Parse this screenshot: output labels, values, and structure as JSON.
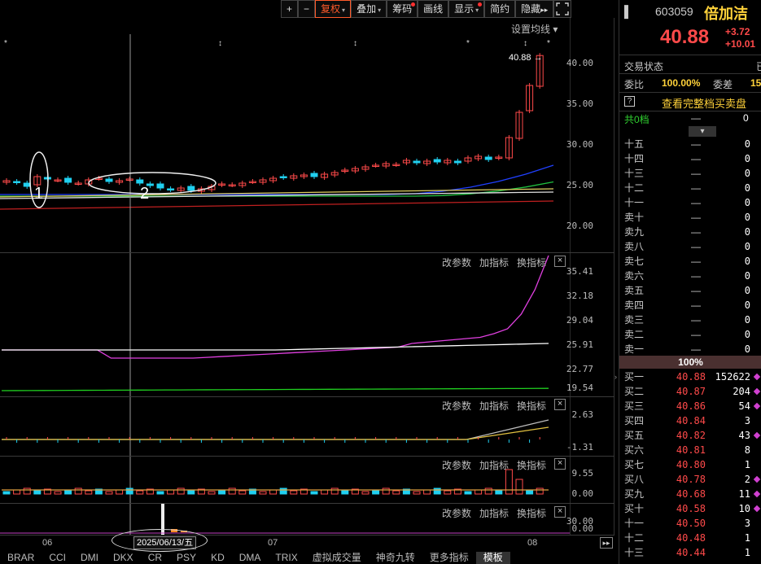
{
  "toolbar": {
    "plus": "+",
    "minus": "−",
    "items": [
      {
        "label": "复权",
        "caret": true,
        "dot": false,
        "active": true
      },
      {
        "label": "叠加",
        "caret": true,
        "dot": false,
        "active": false
      },
      {
        "label": "筹码",
        "caret": false,
        "dot": true,
        "active": false
      },
      {
        "label": "画线",
        "caret": false,
        "dot": false,
        "active": false
      },
      {
        "label": "显示",
        "caret": true,
        "dot": true,
        "active": false
      },
      {
        "label": "简约",
        "caret": false,
        "dot": false,
        "active": false
      },
      {
        "label": "隐藏",
        "caret": false,
        "dot": false,
        "active": false,
        "suffix": "▸▸"
      }
    ]
  },
  "main_chart": {
    "setting_label": "设置均线",
    "last_price_marker": "40.88",
    "y_ticks": [
      "40.00",
      "35.00",
      "30.00",
      "25.00",
      "20.00"
    ],
    "annotations": [
      "1",
      "2"
    ]
  },
  "panel_buttons": {
    "change_params": "改参数",
    "add_indicator": "加指标",
    "switch_indicator": "换指标",
    "close": "×"
  },
  "panel2_ticks": [
    "35.41",
    "32.18",
    "29.04",
    "25.91",
    "22.77",
    "19.54"
  ],
  "panel3_ticks": [
    "2.63",
    "-1.31"
  ],
  "panel4_ticks": [
    "9.55",
    "0.00"
  ],
  "panel5_ticks": [
    "30.00",
    "0.00"
  ],
  "time_axis": {
    "labels": [
      "06",
      "07",
      "08"
    ],
    "cursor_date": "2025/06/13/五"
  },
  "bottom_tabs": [
    "BRAR",
    "CCI",
    "DMI",
    "DKX",
    "CR",
    "PSY",
    "KD",
    "DMA",
    "TRIX",
    "虚拟成交量",
    "神奇九转",
    "更多指标",
    "模板"
  ],
  "bottom_active": "模板",
  "quote": {
    "code": "603059",
    "name": "倍加洁",
    "price": "40.88",
    "change": "+3.72",
    "change_pct": "+10.01",
    "trade_state_label": "交易状态",
    "trade_state_value": "已",
    "webi_label": "委比",
    "webi_value": "100.00%",
    "weicha_label": "委差",
    "weicha_value": "15",
    "full_book_label": "查看完整档买卖盘",
    "help": "?",
    "total_levels_label": "共0档",
    "total_levels_dash": "—",
    "total_levels_value": "0",
    "pct_bar": "100%"
  },
  "sell_levels": [
    {
      "label": "十五",
      "value": "0"
    },
    {
      "label": "十四",
      "value": "0"
    },
    {
      "label": "十三",
      "value": "0"
    },
    {
      "label": "十二",
      "value": "0"
    },
    {
      "label": "十一",
      "value": "0"
    },
    {
      "label": "卖十",
      "value": "0"
    },
    {
      "label": "卖九",
      "value": "0"
    },
    {
      "label": "卖八",
      "value": "0"
    },
    {
      "label": "卖七",
      "value": "0"
    },
    {
      "label": "卖六",
      "value": "0"
    },
    {
      "label": "卖五",
      "value": "0"
    },
    {
      "label": "卖四",
      "value": "0"
    },
    {
      "label": "卖三",
      "value": "0"
    },
    {
      "label": "卖二",
      "value": "0"
    },
    {
      "label": "卖一",
      "value": "0"
    }
  ],
  "buy_levels": [
    {
      "label": "买一",
      "price": "40.88",
      "vol": "152622",
      "mark": true
    },
    {
      "label": "买二",
      "price": "40.87",
      "vol": "204",
      "mark": true
    },
    {
      "label": "买三",
      "price": "40.86",
      "vol": "54",
      "mark": true
    },
    {
      "label": "买四",
      "price": "40.84",
      "vol": "3",
      "mark": false
    },
    {
      "label": "买五",
      "price": "40.82",
      "vol": "43",
      "mark": true
    },
    {
      "label": "买六",
      "price": "40.81",
      "vol": "8",
      "mark": false
    },
    {
      "label": "买七",
      "price": "40.80",
      "vol": "1",
      "mark": false
    },
    {
      "label": "买八",
      "price": "40.78",
      "vol": "2",
      "mark": true
    },
    {
      "label": "买九",
      "price": "40.68",
      "vol": "11",
      "mark": true
    },
    {
      "label": "买十",
      "price": "40.58",
      "vol": "10",
      "mark": true
    },
    {
      "label": "十一",
      "price": "40.50",
      "vol": "3",
      "mark": false
    },
    {
      "label": "十二",
      "price": "40.48",
      "vol": "1",
      "mark": false
    },
    {
      "label": "十三",
      "price": "40.44",
      "vol": "1",
      "mark": false
    }
  ],
  "colors": {
    "up": "#ff4a4a",
    "down": "#20d0f0",
    "accent": "#ff5a2a"
  }
}
